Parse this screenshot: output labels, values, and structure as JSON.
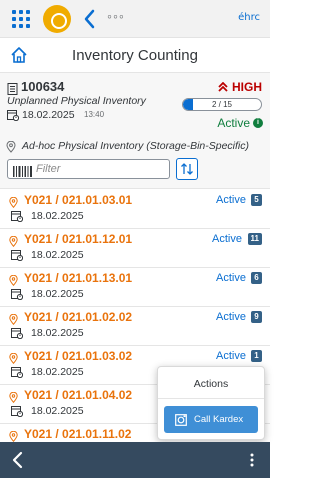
{
  "shell": {
    "brand": "éhrc",
    "more": "◦◦◦"
  },
  "header": {
    "title": "Inventory Counting"
  },
  "document": {
    "id": "100634",
    "priority": "HIGH",
    "type": "Unplanned Physical Inventory",
    "date": "18.02.2025",
    "time": "13:40",
    "progress_text": "2 / 15",
    "progress_value": 0.1333,
    "status": "Active",
    "description": "Ad-hoc Physical Inventory (Storage-Bin-Specific)"
  },
  "filter": {
    "placeholder": "Filter"
  },
  "list": {
    "items": [
      {
        "bin": "Y021 / 021.01.03.01",
        "date": "18.02.2025",
        "status": "Active",
        "count": "5"
      },
      {
        "bin": "Y021 / 021.01.12.01",
        "date": "18.02.2025",
        "status": "Active",
        "count": "11"
      },
      {
        "bin": "Y021 / 021.01.13.01",
        "date": "18.02.2025",
        "status": "Active",
        "count": "6"
      },
      {
        "bin": "Y021 / 021.01.02.02",
        "date": "18.02.2025",
        "status": "Active",
        "count": "9"
      },
      {
        "bin": "Y021 / 021.01.03.02",
        "date": "18.02.2025",
        "status": "Active",
        "count": "1"
      },
      {
        "bin": "Y021 / 021.01.04.02",
        "date": "18.02.2025",
        "status": "",
        "count": ""
      },
      {
        "bin": "Y021 / 021.01.11.02",
        "date": "",
        "status": "",
        "count": ""
      }
    ]
  },
  "actions": {
    "title": "Actions",
    "call_kardex": "Call Kardex"
  },
  "colors": {
    "shell_bg": "#f2f2f2",
    "accent": "#0a6ed1",
    "priority_high": "#bb0000",
    "status_active": "#107e3e",
    "bin_orange": "#e9730c",
    "badge": "#346187",
    "footer": "#354a5f"
  }
}
